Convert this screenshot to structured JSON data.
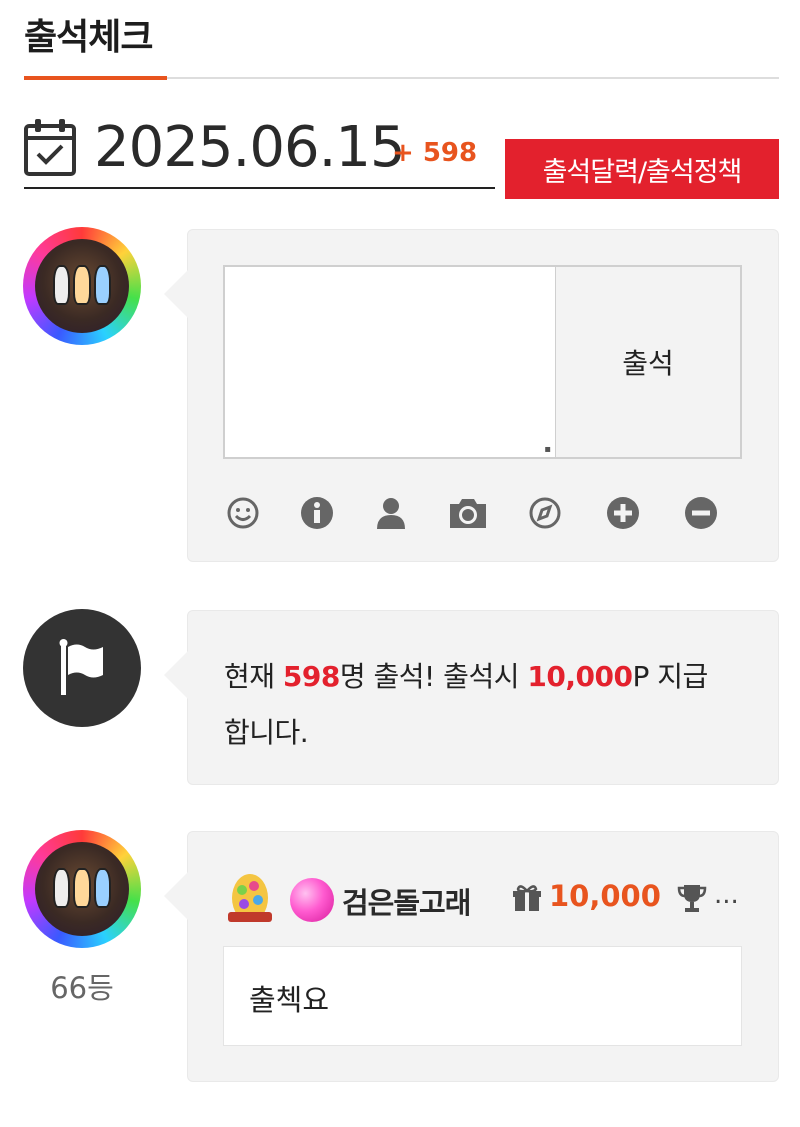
{
  "header": {
    "title": "출석체크"
  },
  "date_row": {
    "date": "2025.06.15",
    "count_badge": "+ 598"
  },
  "actions": {
    "calendar_policy_label": "출석달력/출석정책"
  },
  "compose": {
    "submit_label": "출석",
    "tools": [
      "smile-icon",
      "info-icon",
      "user-icon",
      "camera-icon",
      "compass-icon",
      "plus-circle-icon",
      "minus-circle-icon"
    ]
  },
  "notice": {
    "prefix": "현재 ",
    "count": "598",
    "middle": "명 출석! 출석시 ",
    "reward": "10,000",
    "suffix_line1": "P 지급",
    "line2": "합니다."
  },
  "entry": {
    "nickname": "검은돌고래",
    "points": "10,000",
    "ellipsis": "...",
    "comment": "출첵요",
    "rank": "66등"
  },
  "colors": {
    "accent": "#e8541e",
    "red": "#e3212d",
    "bubble": "#f3f3f3"
  }
}
